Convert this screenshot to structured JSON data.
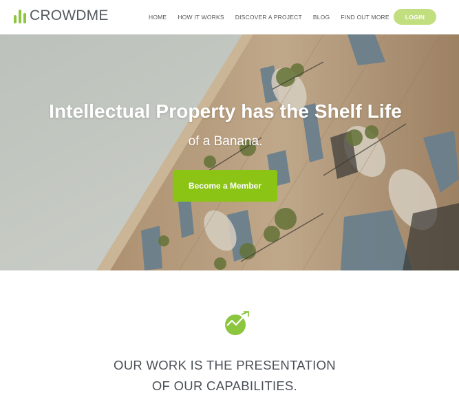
{
  "brand": {
    "name": "CROWDME",
    "accent": "#8cc63f",
    "text_color": "#555a5f"
  },
  "nav": {
    "items": [
      {
        "label": "HOME"
      },
      {
        "label": "HOW IT WORKS"
      },
      {
        "label": "DISCOVER A PROJECT"
      },
      {
        "label": "BLOG"
      },
      {
        "label": "FIND OUT MORE"
      }
    ],
    "login_label": "LOGIN"
  },
  "hero": {
    "title": "Intellectual Property has the Shelf Life",
    "subtitle": "of a Banana.",
    "cta_label": "Become a Member",
    "cta_color": "#8bc415"
  },
  "section": {
    "icon": "growth-arrow-icon",
    "tagline_line1": "OUR WORK IS THE PRESENTATION",
    "tagline_line2": "OF OUR CAPABILITIES."
  }
}
